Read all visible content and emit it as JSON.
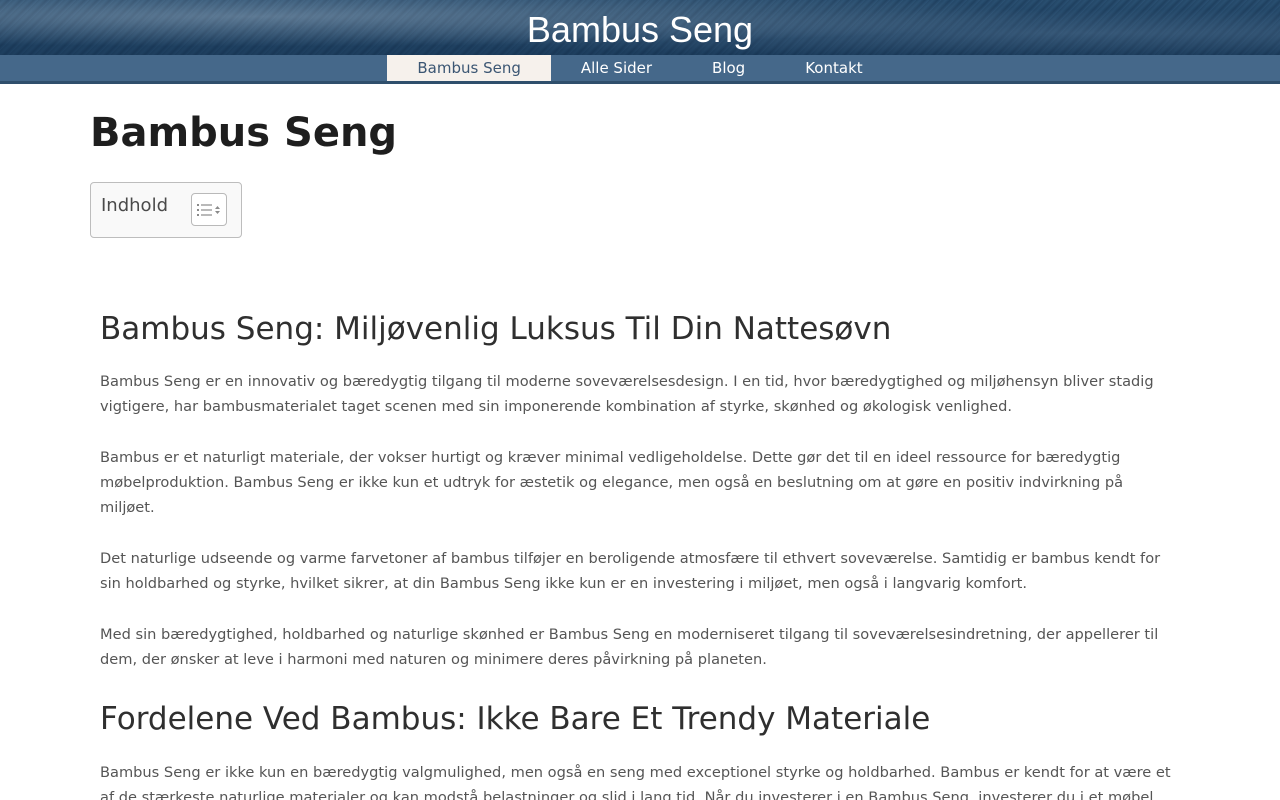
{
  "header": {
    "site_title": "Bambus Seng"
  },
  "nav": {
    "items": [
      {
        "label": "Bambus Seng"
      },
      {
        "label": "Alle Sider"
      },
      {
        "label": "Blog"
      },
      {
        "label": "Kontakt"
      }
    ],
    "active_index": 0
  },
  "page": {
    "title": "Bambus Seng"
  },
  "toc": {
    "title": "Indhold",
    "toggle_icon": "list-toggle-icon"
  },
  "article": {
    "heading_1": "Bambus Seng: Miljøvenlig Luksus Til Din Nattesøvn",
    "paragraphs_1": [
      "Bambus Seng er en innovativ og bæredygtig tilgang til moderne soveværelsesdesign. I en tid, hvor bæredygtighed og miljøhensyn bliver stadig vigtigere, har bambusmaterialet taget scenen med sin imponerende kombination af styrke, skønhed og økologisk venlighed.",
      "Bambus er et naturligt materiale, der vokser hurtigt og kræver minimal vedligeholdelse. Dette gør det til en ideel ressource for bæredygtig møbelproduktion. Bambus Seng er ikke kun et udtryk for æstetik og elegance, men også en beslutning om at gøre en positiv indvirkning på miljøet.",
      "Det naturlige udseende og varme farvetoner af bambus tilføjer en beroligende atmosfære til ethvert soveværelse. Samtidig er bambus kendt for sin holdbarhed og styrke, hvilket sikrer, at din Bambus Seng ikke kun er en investering i miljøet, men også i langvarig komfort.",
      "Med sin bæredygtighed, holdbarhed og naturlige skønhed er Bambus Seng en moderniseret tilgang til soveværelsesindretning, der appellerer til dem, der ønsker at leve i harmoni med naturen og minimere deres påvirkning på planeten."
    ],
    "heading_2": "Fordelene Ved Bambus: Ikke Bare Et Trendy Materiale",
    "paragraphs_2": [
      "Bambus Seng er ikke kun en bæredygtig valgmulighed, men også en seng med exceptionel styrke og holdbarhed. Bambus er kendt for at være et af de stærkeste naturlige materialer og kan modstå belastninger og slid i lang tid. Når du investerer i en Bambus Seng, investerer du i et møbel, der er bygget til at vare i mange år fremover."
    ]
  },
  "colors": {
    "nav_bg": "#45688a",
    "nav_active_bg": "#f6f1ec",
    "header_bg": "#2d5678"
  }
}
